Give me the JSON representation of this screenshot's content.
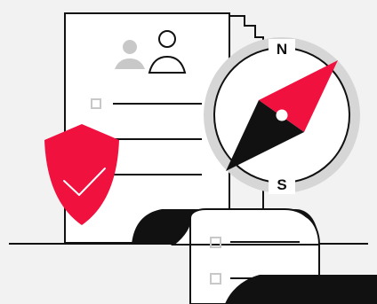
{
  "compass": {
    "north_label": "N",
    "south_label": "S"
  },
  "icons": [
    "document-icon",
    "profile-icon",
    "checkbox-icon",
    "shield-check-icon",
    "compass-icon",
    "receipt-scroll-icon"
  ],
  "colors": {
    "background": "#f2f2f2",
    "ink": "#111111",
    "paper": "#ffffff",
    "accent_red": "#f0113f",
    "compass_face": "#d6d6d6",
    "placeholder_gray": "#c8c8c8"
  }
}
